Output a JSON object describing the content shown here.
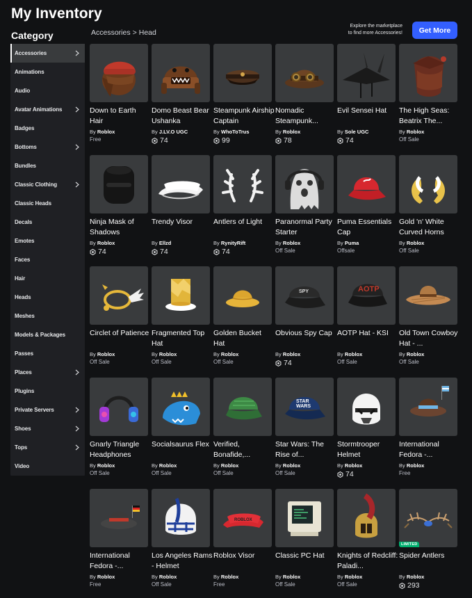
{
  "page": {
    "title": "My Inventory",
    "category_heading": "Category"
  },
  "breadcrumb": {
    "parent": "Accessories",
    "separator": ">",
    "current": "Head"
  },
  "promo": {
    "line1": "Explore the marketplace",
    "line2": "to find more Accessories!",
    "button_label": "Get More"
  },
  "categories": [
    {
      "label": "Accessories",
      "chevron": true,
      "active": true
    },
    {
      "label": "Animations",
      "chevron": false
    },
    {
      "label": "Audio",
      "chevron": false
    },
    {
      "label": "Avatar Animations",
      "chevron": true
    },
    {
      "label": "Badges",
      "chevron": false
    },
    {
      "label": "Bottoms",
      "chevron": true
    },
    {
      "label": "Bundles",
      "chevron": false
    },
    {
      "label": "Classic Clothing",
      "chevron": true
    },
    {
      "label": "Classic Heads",
      "chevron": false
    },
    {
      "label": "Decals",
      "chevron": false
    },
    {
      "label": "Emotes",
      "chevron": false
    },
    {
      "label": "Faces",
      "chevron": false
    },
    {
      "label": "Hair",
      "chevron": false
    },
    {
      "label": "Heads",
      "chevron": false
    },
    {
      "label": "Meshes",
      "chevron": false
    },
    {
      "label": "Models & Packages",
      "chevron": false
    },
    {
      "label": "Passes",
      "chevron": false
    },
    {
      "label": "Places",
      "chevron": true
    },
    {
      "label": "Plugins",
      "chevron": false
    },
    {
      "label": "Private Servers",
      "chevron": true
    },
    {
      "label": "Shoes",
      "chevron": true
    },
    {
      "label": "Tops",
      "chevron": true
    },
    {
      "label": "Video",
      "chevron": false
    }
  ],
  "creator_prefix": "By",
  "items": [
    {
      "name": "Down to Earth Hair",
      "creator": "Roblox",
      "price": "Free",
      "price_type": "text",
      "icon": "hair-beanie"
    },
    {
      "name": "Domo Beast Bear Ushanka",
      "creator": "J.LV.O UGC",
      "price": "74",
      "price_type": "robux",
      "icon": "domo-hat"
    },
    {
      "name": "Steampunk Airship Captain",
      "creator": "WhoToTrus",
      "price": "99",
      "price_type": "robux",
      "icon": "captain-hat"
    },
    {
      "name": "Nomadic Steampunk...",
      "creator": "Roblox",
      "price": "78",
      "price_type": "robux",
      "icon": "goggles-hat"
    },
    {
      "name": "Evil Sensei Hat",
      "creator": "Sole UGC",
      "price": "74",
      "price_type": "robux",
      "icon": "sensei-hat"
    },
    {
      "name": "The High Seas: Beatrix The...",
      "creator": "Roblox",
      "price": "Off Sale",
      "price_type": "text",
      "icon": "pirate-hair"
    },
    {
      "name": "Ninja Mask of Shadows",
      "creator": "Roblox",
      "price": "74",
      "price_type": "robux",
      "icon": "ninja-mask"
    },
    {
      "name": "Trendy Visor",
      "creator": "Ellzd",
      "price": "74",
      "price_type": "robux",
      "icon": "white-visor"
    },
    {
      "name": "Antlers of Light",
      "creator": "RynityRift",
      "price": "74",
      "price_type": "robux",
      "icon": "white-antlers"
    },
    {
      "name": "Paranormal Party Starter",
      "creator": "Roblox",
      "price": "Off Sale",
      "price_type": "text",
      "icon": "ghost-headphones"
    },
    {
      "name": "Puma Essentials Cap",
      "creator": "Puma",
      "price": "Offsale",
      "price_type": "text",
      "icon": "red-cap"
    },
    {
      "name": "Gold 'n' White Curved Horns",
      "creator": "Roblox",
      "price": "Off Sale",
      "price_type": "text",
      "icon": "curved-horns"
    },
    {
      "name": "Circlet of Patience",
      "creator": "Roblox",
      "price": "Off Sale",
      "price_type": "text",
      "icon": "winged-circlet"
    },
    {
      "name": "Fragmented Top Hat",
      "creator": "Roblox",
      "price": "Off Sale",
      "price_type": "text",
      "icon": "gold-top-hat"
    },
    {
      "name": "Golden Bucket Hat",
      "creator": "Roblox",
      "price": "Off Sale",
      "price_type": "text",
      "icon": "bucket-hat"
    },
    {
      "name": "Obvious Spy Cap",
      "creator": "Roblox",
      "price": "74",
      "price_type": "robux",
      "icon": "spy-cap"
    },
    {
      "name": "AOTP Hat - KSI",
      "creator": "Roblox",
      "price": "Off Sale",
      "price_type": "text",
      "icon": "aotp-cap"
    },
    {
      "name": "Old Town Cowboy Hat - ...",
      "creator": "Roblox",
      "price": "Off Sale",
      "price_type": "text",
      "icon": "cowboy-hat"
    },
    {
      "name": "Gnarly Triangle Headphones",
      "creator": "Roblox",
      "price": "Off Sale",
      "price_type": "text",
      "icon": "headphones"
    },
    {
      "name": "Socialsaurus Flex",
      "creator": "Roblox",
      "price": "Off Sale",
      "price_type": "text",
      "icon": "dino-hat"
    },
    {
      "name": "Verified, Bonafide,...",
      "creator": "Roblox",
      "price": "Off Sale",
      "price_type": "text",
      "icon": "green-cap"
    },
    {
      "name": "Star Wars: The Rise of...",
      "creator": "Roblox",
      "price": "Off Sale",
      "price_type": "text",
      "icon": "starwars-cap"
    },
    {
      "name": "Stormtrooper Helmet",
      "creator": "Roblox",
      "price": "74",
      "price_type": "robux",
      "icon": "stormtrooper-helmet"
    },
    {
      "name": "International Fedora -...",
      "creator": "Roblox",
      "price": "Free",
      "price_type": "text",
      "icon": "fedora-argentina"
    },
    {
      "name": "International Fedora -...",
      "creator": "Roblox",
      "price": "Free",
      "price_type": "text",
      "icon": "fedora-germany"
    },
    {
      "name": "Los Angeles Rams - Helmet",
      "creator": "Roblox",
      "price": "Off Sale",
      "price_type": "text",
      "icon": "rams-helmet"
    },
    {
      "name": "Roblox Visor",
      "creator": "Roblox",
      "price": "Free",
      "price_type": "text",
      "icon": "red-visor"
    },
    {
      "name": "Classic PC Hat",
      "creator": "Roblox",
      "price": "Off Sale",
      "price_type": "text",
      "icon": "pc-hat"
    },
    {
      "name": "Knights of Redcliff: Paladi...",
      "creator": "Roblox",
      "price": "Off Sale",
      "price_type": "text",
      "icon": "paladin-helmet"
    },
    {
      "name": "Spider Antlers",
      "creator": "Roblox",
      "price": "293",
      "price_type": "robux",
      "icon": "spider-antlers",
      "badge": "LIMITED"
    }
  ],
  "colors": {
    "background": "#111214",
    "sidebar": "#1f2024",
    "card": "#393b3d",
    "accent": "#335fff",
    "limited": "#00b06f"
  }
}
